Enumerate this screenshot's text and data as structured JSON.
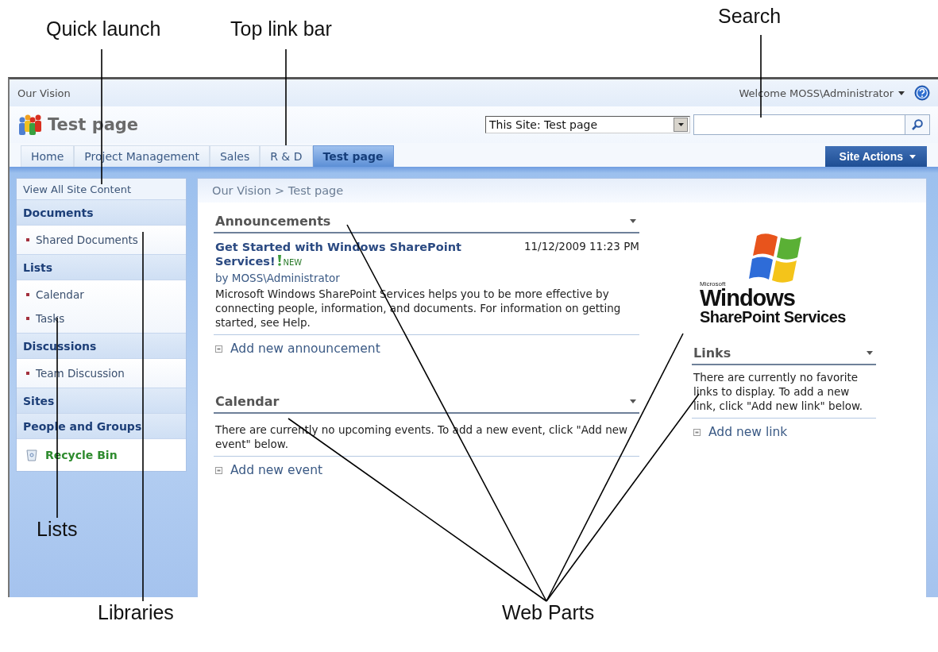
{
  "annotations": [
    {
      "label": "Quick launch"
    },
    {
      "label": "Top link bar"
    },
    {
      "label": "Search"
    },
    {
      "label": "Lists"
    },
    {
      "label": "Libraries"
    },
    {
      "label": "Web Parts"
    }
  ],
  "header": {
    "site_title": "Our Vision",
    "welcome": "Welcome MOSS\\Administrator",
    "page_title": "Test page",
    "search_scope": "This Site: Test page"
  },
  "top_nav": [
    {
      "label": "Home",
      "selected": false
    },
    {
      "label": "Project Management",
      "selected": false
    },
    {
      "label": "Sales",
      "selected": false
    },
    {
      "label": "R & D",
      "selected": false
    },
    {
      "label": "Test page",
      "selected": true
    }
  ],
  "site_actions": "Site Actions",
  "quick_launch": {
    "view_all": "View All Site Content",
    "sections": [
      {
        "title": "Documents",
        "items": [
          "Shared Documents"
        ]
      },
      {
        "title": "Lists",
        "items": [
          "Calendar",
          "Tasks"
        ]
      },
      {
        "title": "Discussions",
        "items": [
          "Team Discussion"
        ]
      },
      {
        "title": "Sites"
      },
      {
        "title": "People and Groups"
      }
    ],
    "recycle_bin": "Recycle Bin"
  },
  "breadcrumb": "Our Vision > Test page",
  "announcements": {
    "title": "Announcements",
    "items": [
      {
        "title": "Get Started with Windows SharePoint Services!",
        "badge": "NEW",
        "date": "11/12/2009 11:23 PM",
        "author": "by MOSS\\Administrator",
        "body": "Microsoft Windows SharePoint Services helps you to be more effective by connecting people, information, and documents. For information on getting started, see Help."
      }
    ],
    "add_link": "Add new announcement"
  },
  "calendar": {
    "title": "Calendar",
    "message": "There are currently no upcoming events. To add a new event, click \"Add new event\" below.",
    "add_link": "Add new event"
  },
  "logo": {
    "small": "Microsoft",
    "line1": "Windows",
    "line2": "SharePoint Services"
  },
  "links": {
    "title": "Links",
    "message": "There are currently no favorite links to display. To add a new link, click \"Add new link\" below.",
    "add_link": "Add new link"
  }
}
